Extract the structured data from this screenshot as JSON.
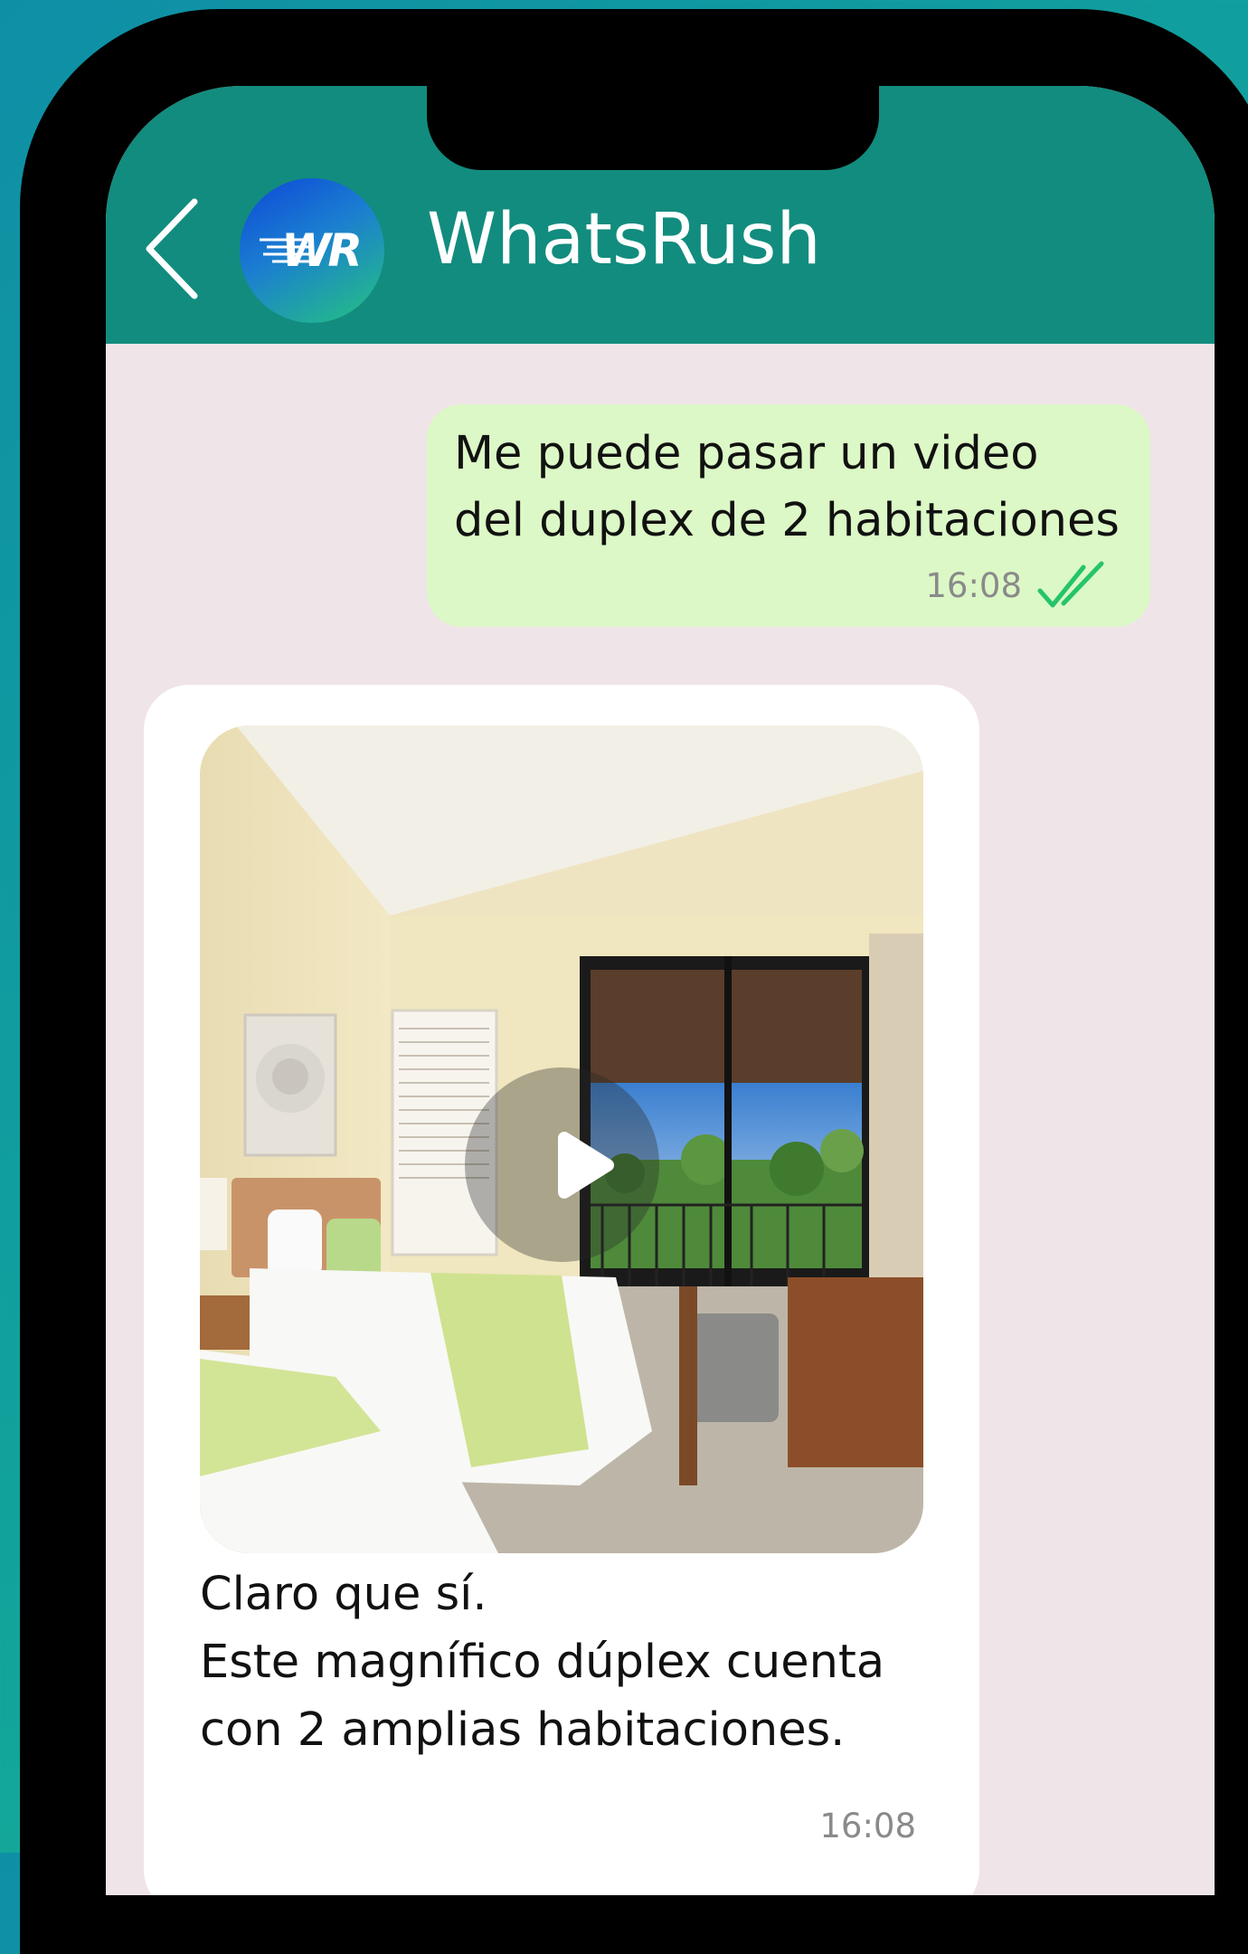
{
  "header": {
    "title": "WhatsRush",
    "avatar_initials": "WR",
    "back_icon": "chevron-left-icon"
  },
  "messages": [
    {
      "direction": "outgoing",
      "lines": [
        "Me puede pasar un video",
        "del duplex de 2 habitaciones"
      ],
      "time": "16:08",
      "status_icon": "double-check-icon"
    },
    {
      "direction": "incoming",
      "media": {
        "type": "video",
        "icon": "play-icon"
      },
      "lines": [
        "Claro que sí.",
        "Este magnífico dúplex cuenta",
        "con 2 amplias habitaciones."
      ],
      "time": "16:08"
    }
  ],
  "colors": {
    "header": "#128c7e",
    "chat_background": "#efe4e8",
    "outgoing_bubble": "#dcf8c6",
    "incoming_bubble": "#ffffff",
    "read_ticks": "#25c46a"
  }
}
